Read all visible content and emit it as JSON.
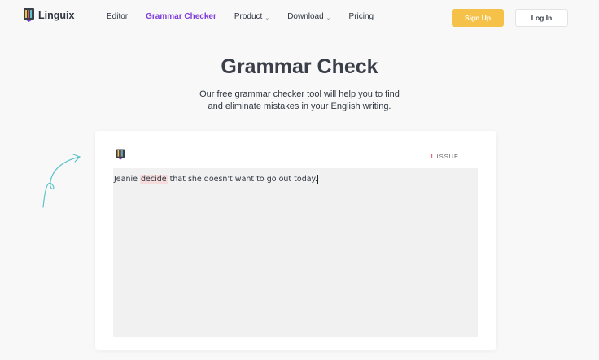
{
  "header": {
    "logo_text": "Linguix",
    "nav": [
      {
        "label": "Editor",
        "active": false,
        "dropdown": false
      },
      {
        "label": "Grammar Checker",
        "active": true,
        "dropdown": false
      },
      {
        "label": "Product",
        "active": false,
        "dropdown": true
      },
      {
        "label": "Download",
        "active": false,
        "dropdown": true
      },
      {
        "label": "Pricing",
        "active": false,
        "dropdown": false
      }
    ],
    "signup_label": "Sign Up",
    "login_label": "Log In"
  },
  "hero": {
    "title": "Grammar Check",
    "subtitle_line1": "Our free grammar checker tool will help you to find",
    "subtitle_line2": "and eliminate mistakes in your English writing."
  },
  "editor": {
    "issue_count": "1",
    "issue_label": "ISSUE",
    "text_before": "Jeanie ",
    "error_word": "decide",
    "text_after": " that she doesn't want to go out today."
  },
  "colors": {
    "accent": "#7e3bd9",
    "signup_bg": "#f5c148",
    "error_highlight": "#f6dcdc",
    "issue_count": "#e0566b",
    "arrow": "#5bc3c9"
  }
}
